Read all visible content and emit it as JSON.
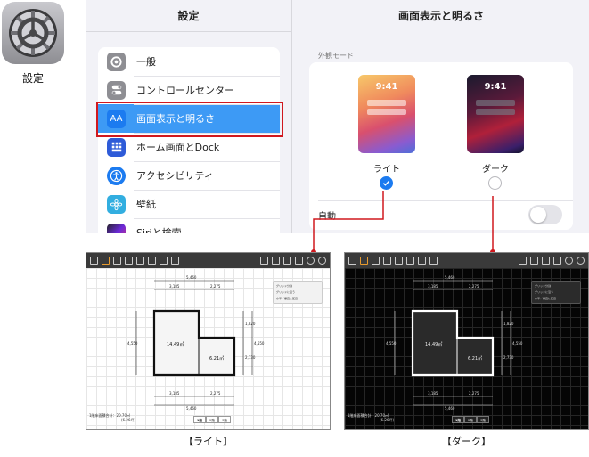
{
  "app_icon": {
    "label": "設定"
  },
  "settings": {
    "title": "設定",
    "items": [
      {
        "label": "一般",
        "icon": "gear-icon",
        "color": "#8e8e93"
      },
      {
        "label": "コントロールセンター",
        "icon": "toggles-icon",
        "color": "#8e8e93"
      },
      {
        "label": "画面表示と明るさ",
        "icon": "text-size-icon",
        "color": "#1c7bf0",
        "glyph": "AA",
        "selected": true
      },
      {
        "label": "ホーム画面とDock",
        "icon": "home-grid-icon",
        "color": "#2e5bd8"
      },
      {
        "label": "アクセシビリティ",
        "icon": "accessibility-icon",
        "color": "#1c7bf0"
      },
      {
        "label": "壁紙",
        "icon": "wallpaper-flower-icon",
        "color": "#32aee0"
      },
      {
        "label": "Siriと検索",
        "icon": "siri-icon",
        "color": "#222222"
      }
    ]
  },
  "display": {
    "title": "画面表示と明るさ",
    "section_label": "外観モード",
    "light": {
      "label": "ライト",
      "time": "9:41",
      "selected": true
    },
    "dark": {
      "label": "ダーク",
      "time": "9:41",
      "selected": false
    },
    "auto_label": "自動",
    "auto_on": false
  },
  "screenshots": {
    "light": {
      "caption": "【ライト】",
      "area_note": [
        "1階床面積合計：20.70㎡",
        "(6.26坪)"
      ],
      "room_large": "14.49㎡",
      "room_small": "6.21㎡",
      "dims": {
        "top_total": "5,460",
        "top_left": "3,185",
        "top_right": "2,275",
        "bottom_left": "3,185",
        "bottom_right": "2,275",
        "bottom_total": "5,460",
        "left": "4,550",
        "right_total": "4,550",
        "right_top": "1,820",
        "right_bottom": "2,730"
      },
      "panel": [
        "グリッド分割",
        "グリッドに沿う",
        "水平／垂直に配置"
      ],
      "floors": [
        "1階",
        "2階",
        "3階"
      ]
    },
    "dark": {
      "caption": "【ダーク】",
      "area_note": [
        "1階床面積合計：20.70㎡",
        "(6.26坪)"
      ],
      "room_large": "14.49㎡",
      "room_small": "6.21㎡",
      "dims": {
        "top_total": "5,460",
        "top_left": "3,185",
        "top_right": "2,275",
        "bottom_left": "3,185",
        "bottom_right": "2,275",
        "bottom_total": "5,460",
        "left": "4,550",
        "right_total": "4,550",
        "right_top": "1,820",
        "right_bottom": "2,730"
      },
      "panel": [
        "グリッド分割",
        "グリッドに沿う",
        "水平／垂直に配置"
      ],
      "floors": [
        "1階",
        "2階",
        "3階"
      ]
    }
  },
  "colors": {
    "accent": "#1c7bf0",
    "highlight_frame": "#d0181e",
    "selected_row": "#3d9af5"
  }
}
